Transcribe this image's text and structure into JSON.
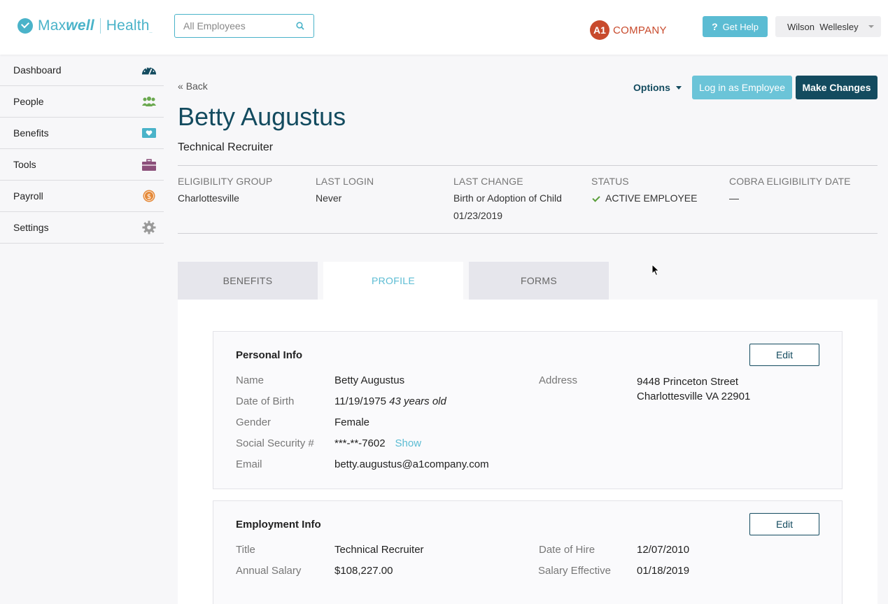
{
  "header": {
    "logo_word1": "Max",
    "logo_word2": "well",
    "logo_word3": "Health",
    "logo_tm": "..",
    "search_placeholder": "All Employees",
    "company_badge": "A1",
    "company_name": "COMPANY",
    "help_label": "Get Help",
    "user_name": "Wilson  Wellesley"
  },
  "sidebar": {
    "items": [
      {
        "label": "Dashboard",
        "icon": "gauge-icon"
      },
      {
        "label": "People",
        "icon": "people-icon"
      },
      {
        "label": "Benefits",
        "icon": "heart-icon"
      },
      {
        "label": "Tools",
        "icon": "briefcase-icon"
      },
      {
        "label": "Payroll",
        "icon": "dollar-coin-icon"
      },
      {
        "label": "Settings",
        "icon": "gear-icon"
      }
    ]
  },
  "page": {
    "back": "Back",
    "title": "Betty Augustus",
    "subtitle": "Technical Recruiter",
    "options_label": "Options",
    "login_button": "Log in as Employee",
    "changes_button": "Make Changes"
  },
  "meta": {
    "eligibility_label": "Eligibility Group",
    "eligibility_value": "Charlottesville",
    "last_login_label": "Last Login",
    "last_login_value": "Never",
    "last_change_label": "Last Change",
    "last_change_value": "Birth or Adoption of Child",
    "last_change_date": "01/23/2019",
    "status_label": "Status",
    "status_value": "ACTIVE EMPLOYEE",
    "cobra_label": "Cobra Eligibility Date",
    "cobra_value": "—"
  },
  "tabs": [
    {
      "label": "BENEFITS",
      "active": false
    },
    {
      "label": "PROFILE",
      "active": true
    },
    {
      "label": "FORMS",
      "active": false
    }
  ],
  "personal": {
    "title": "Personal Info",
    "edit": "Edit",
    "name_label": "Name",
    "name_value": "Betty Augustus",
    "dob_label": "Date of Birth",
    "dob_value": "11/19/1975",
    "age_value": "43 years old",
    "gender_label": "Gender",
    "gender_value": "Female",
    "ssn_label": "Social Security #",
    "ssn_value": "***-**-7602",
    "ssn_show": "Show",
    "email_label": "Email",
    "email_value": "betty.augustus@a1company.com",
    "address_label": "Address",
    "address_line1": "9448 Princeton Street",
    "address_line2": "Charlottesville VA 22901"
  },
  "employment": {
    "title": "Employment Info",
    "edit": "Edit",
    "title_label": "Title",
    "title_value": "Technical Recruiter",
    "salary_label": "Annual Salary",
    "salary_value": "$108,227.00",
    "hire_label": "Date of Hire",
    "hire_value": "12/07/2010",
    "effective_label": "Salary Effective",
    "effective_value": "01/18/2019"
  },
  "colors": {
    "brand": "#4ab3c9",
    "primary_dark": "#134b5f",
    "accent": "#5bbcd3",
    "company": "#c84a2c"
  }
}
